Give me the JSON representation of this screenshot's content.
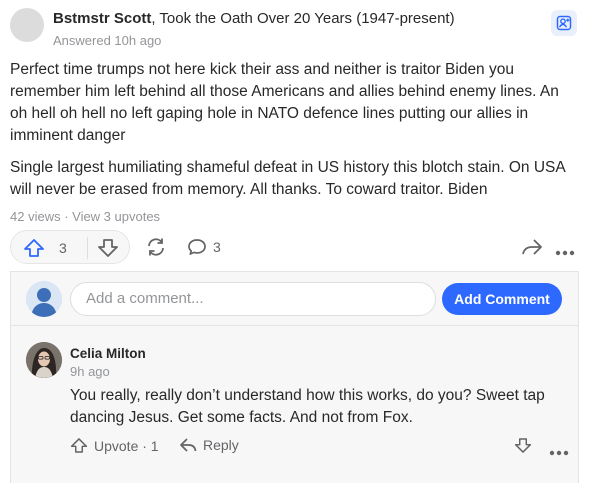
{
  "answer": {
    "author_name": "Bstmstr Scott",
    "author_credential": ", Took the Oath Over 20 Years (1947-present)",
    "answered_time": "Answered 10h ago",
    "paragraphs": [
      "Perfect time trumps not here kick their ass and neither is traitor Biden you remember him left behind all those Americans and allies behind enemy lines. An oh hell oh hell no left gaping hole in NATO defence lines putting our allies in imminent danger",
      "Single largest humiliating shameful defeat in US history this blotch stain. On USA will never be erased from memory. All thanks. To coward traitor. Biden"
    ],
    "stats": "42 views · View 3 upvotes",
    "upvote_count": "3",
    "comment_count": "3"
  },
  "comment_box": {
    "placeholder": "Add a comment...",
    "submit_label": "Add Comment"
  },
  "comment": {
    "author_name": "Celia Milton",
    "time": "9h ago",
    "text": "You really, really don’t understand how this works, do you? Sweet tap dancing Jesus. Get some facts. And not from Fox.",
    "upvote_label": "Upvote · 1",
    "reply_label": "Reply"
  },
  "colors": {
    "accent": "#2e69ff",
    "muted_text": "#939598",
    "body_text": "#282829"
  }
}
